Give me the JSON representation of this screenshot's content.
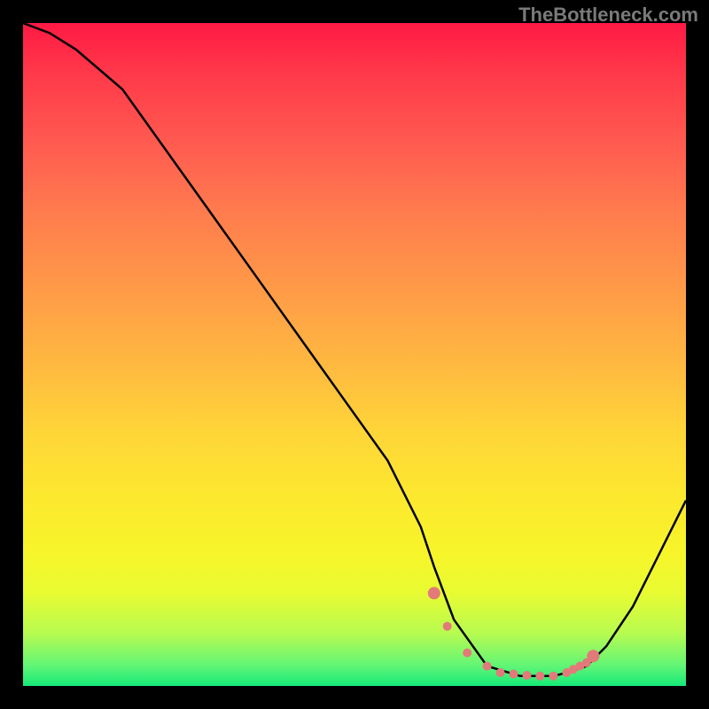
{
  "watermark": "TheBottleneck.com",
  "chart_data": {
    "type": "line",
    "title": "",
    "xlabel": "",
    "ylabel": "",
    "xlim": [
      0,
      100
    ],
    "ylim": [
      0,
      100
    ],
    "series": [
      {
        "name": "bottleneck-curve",
        "x": [
          0,
          4,
          8,
          15,
          25,
          35,
          45,
          55,
          60,
          62,
          65,
          70,
          75,
          80,
          82,
          85,
          88,
          92,
          96,
          100
        ],
        "y": [
          100,
          98.5,
          96,
          90,
          76,
          62,
          48,
          34,
          24,
          18,
          10,
          3,
          1.5,
          1.5,
          2,
          3,
          6,
          12,
          20,
          28
        ]
      }
    ],
    "highlight_points": {
      "name": "match-range-dots",
      "color": "#e27a7a",
      "x": [
        62,
        64,
        67,
        70,
        72,
        74,
        76,
        78,
        80,
        82,
        83,
        84,
        85,
        86
      ],
      "y": [
        14,
        9,
        5,
        3,
        2,
        1.8,
        1.6,
        1.5,
        1.5,
        2,
        2.5,
        3,
        3.5,
        4.5
      ]
    },
    "gradient": {
      "description": "Vertical gradient red (top, high mismatch) to green (bottom, optimal match)",
      "stops": [
        {
          "pos": 0,
          "color": "#ff1a44"
        },
        {
          "pos": 50,
          "color": "#ffc838"
        },
        {
          "pos": 85,
          "color": "#f0f82c"
        },
        {
          "pos": 100,
          "color": "#15ea79"
        }
      ]
    }
  }
}
